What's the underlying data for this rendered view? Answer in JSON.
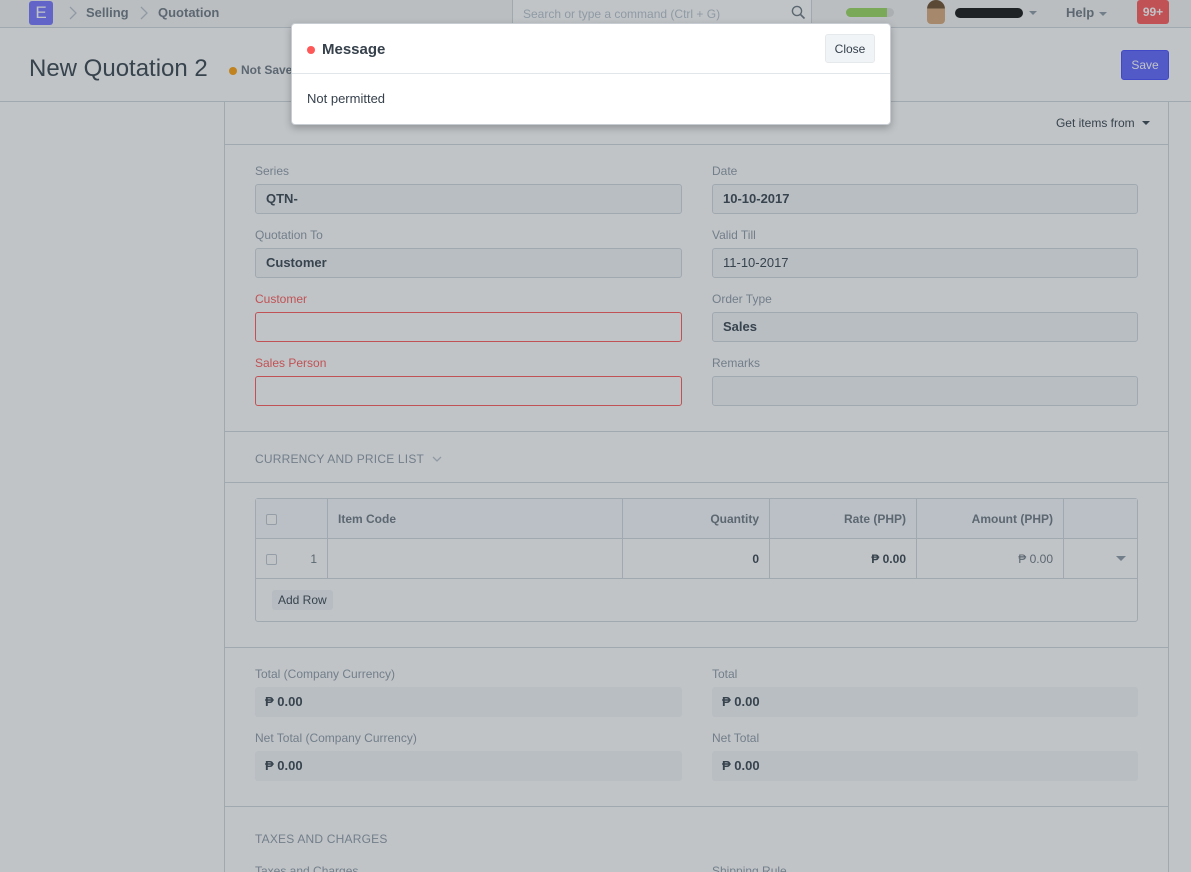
{
  "navbar": {
    "logo_letter": "E",
    "breadcrumbs": [
      "Selling",
      "Quotation"
    ],
    "search_placeholder": "Search or type a command (Ctrl + G)",
    "help_label": "Help",
    "notification_count": "99+",
    "progress_fraction": 0.85
  },
  "page": {
    "title": "New Quotation 2",
    "status": "Not Saved",
    "save_label": "Save"
  },
  "toolbar": {
    "get_items_label": "Get items from"
  },
  "form": {
    "series": {
      "label": "Series",
      "value": "QTN-"
    },
    "date": {
      "label": "Date",
      "value": "10-10-2017"
    },
    "quotation_to": {
      "label": "Quotation To",
      "value": "Customer"
    },
    "valid_till": {
      "label": "Valid Till",
      "value": "11-10-2017"
    },
    "customer": {
      "label": "Customer",
      "value": ""
    },
    "order_type": {
      "label": "Order Type",
      "value": "Sales"
    },
    "sales_person": {
      "label": "Sales Person",
      "value": ""
    },
    "remarks": {
      "label": "Remarks",
      "value": ""
    }
  },
  "sections": {
    "currency": "CURRENCY AND PRICE LIST",
    "taxes": "TAXES AND CHARGES",
    "taxes_field": "Taxes and Charges",
    "shipping_field": "Shipping Rule"
  },
  "items_table": {
    "columns": [
      "Item Code",
      "Quantity",
      "Rate (PHP)",
      "Amount (PHP)"
    ],
    "rows": [
      {
        "idx": "1",
        "item_code": "",
        "quantity": "0",
        "rate": "₱ 0.00",
        "amount": "₱ 0.00"
      }
    ],
    "add_row_label": "Add Row"
  },
  "totals": {
    "total_company": {
      "label": "Total (Company Currency)",
      "value": "₱ 0.00"
    },
    "total": {
      "label": "Total",
      "value": "₱ 0.00"
    },
    "net_total_company": {
      "label": "Net Total (Company Currency)",
      "value": "₱ 0.00"
    },
    "net_total": {
      "label": "Net Total",
      "value": "₱ 0.00"
    }
  },
  "modal": {
    "title": "Message",
    "close_label": "Close",
    "body": "Not permitted"
  },
  "colors": {
    "primary": "#5e64ff",
    "error": "#ff5858",
    "warning": "#ffa00a"
  }
}
